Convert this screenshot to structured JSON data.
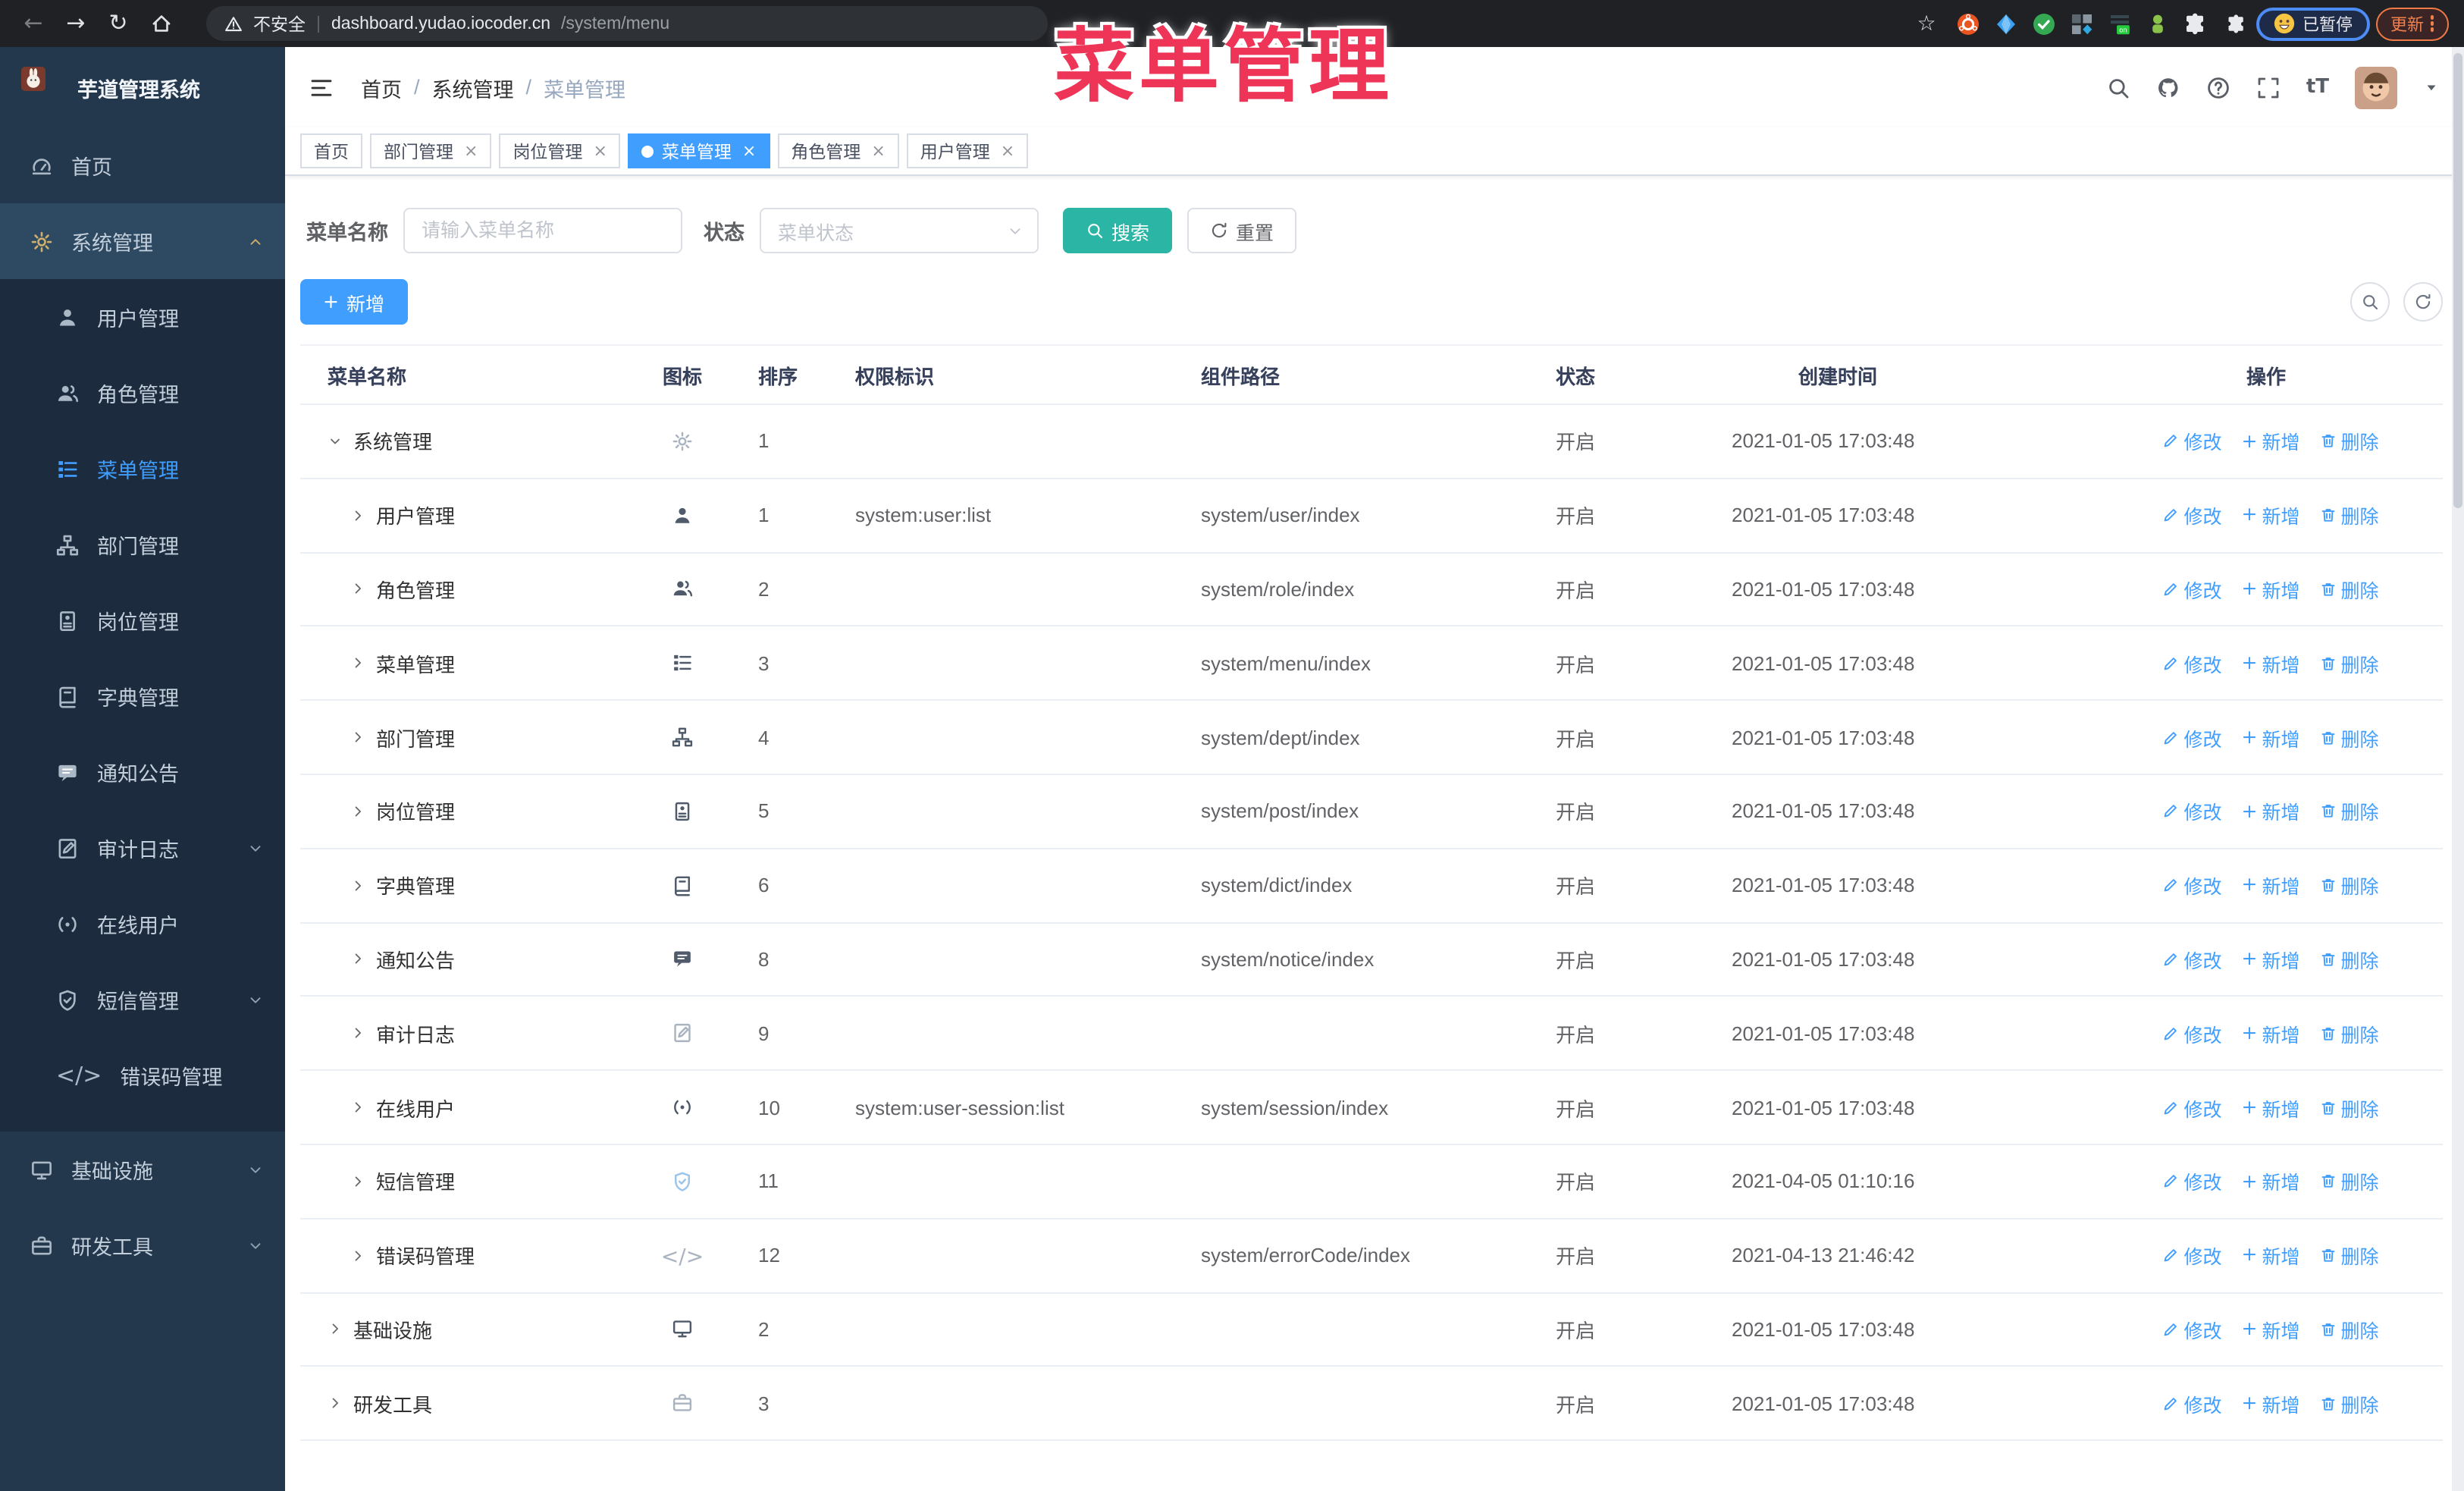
{
  "colors": {
    "accent": "#409eff",
    "teal": "#2bb5a5",
    "overlay": "#ee3558",
    "sidebar_bg": "#24384d"
  },
  "browser": {
    "insecure_label": "不安全",
    "url_host": "dashboard.yudao.iocoder.cn",
    "url_path": "/system/menu",
    "extension_icons": [
      "ubuntu",
      "gem",
      "verified",
      "grid",
      "onpage",
      "bot",
      "puzzle"
    ],
    "paused_badge": "已暂停",
    "update_button": "更新"
  },
  "overlay": {
    "title": "菜单管理"
  },
  "sidebar": {
    "logo_title": "芋道管理系统",
    "items": [
      {
        "label": "首页",
        "icon": "dashboard"
      },
      {
        "label": "系统管理",
        "icon": "gear",
        "highlight": true,
        "arrow": "chevron-up",
        "children": [
          {
            "label": "用户管理",
            "icon": "user"
          },
          {
            "label": "角色管理",
            "icon": "users"
          },
          {
            "label": "菜单管理",
            "icon": "menu",
            "active": true
          },
          {
            "label": "部门管理",
            "icon": "org"
          },
          {
            "label": "岗位管理",
            "icon": "post"
          },
          {
            "label": "字典管理",
            "icon": "dict"
          },
          {
            "label": "通知公告",
            "icon": "message"
          },
          {
            "label": "审计日志",
            "icon": "log",
            "arrow": "chevron-down"
          },
          {
            "label": "在线用户",
            "icon": "online"
          },
          {
            "label": "短信管理",
            "icon": "shield",
            "arrow": "chevron-down"
          },
          {
            "label": "错误码管理",
            "icon": "code"
          }
        ]
      },
      {
        "label": "基础设施",
        "icon": "monitor",
        "arrow": "chevron-down"
      },
      {
        "label": "研发工具",
        "icon": "toolbox",
        "arrow": "chevron-down"
      }
    ]
  },
  "header": {
    "breadcrumb": [
      "首页",
      "系统管理",
      "菜单管理"
    ]
  },
  "tabs": [
    {
      "label": "首页",
      "closable": false,
      "active": false
    },
    {
      "label": "部门管理",
      "closable": true,
      "active": false
    },
    {
      "label": "岗位管理",
      "closable": true,
      "active": false
    },
    {
      "label": "菜单管理",
      "closable": true,
      "active": true
    },
    {
      "label": "角色管理",
      "closable": true,
      "active": false
    },
    {
      "label": "用户管理",
      "closable": true,
      "active": false
    }
  ],
  "filters": {
    "name_label": "菜单名称",
    "name_placeholder": "请输入菜单名称",
    "name_value": "",
    "status_label": "状态",
    "status_placeholder": "菜单状态",
    "search_label": "搜索",
    "reset_label": "重置"
  },
  "toolbar": {
    "add_label": "新增"
  },
  "table": {
    "columns": [
      "菜单名称",
      "图标",
      "排序",
      "权限标识",
      "组件路径",
      "状态",
      "创建时间",
      "操作"
    ],
    "action_labels": {
      "edit": "修改",
      "add": "新增",
      "delete": "删除"
    },
    "rows": [
      {
        "name": "系统管理",
        "level": 0,
        "expanded": true,
        "icon": "gear",
        "icon_tone": "light",
        "sort": "1",
        "perm": "",
        "path": "",
        "status": "开启",
        "time": "2021-01-05 17:03:48"
      },
      {
        "name": "用户管理",
        "level": 1,
        "expanded": false,
        "icon": "user",
        "icon_tone": "dark",
        "sort": "1",
        "perm": "system:user:list",
        "path": "system/user/index",
        "status": "开启",
        "time": "2021-01-05 17:03:48"
      },
      {
        "name": "角色管理",
        "level": 1,
        "expanded": false,
        "icon": "users",
        "icon_tone": "dark",
        "sort": "2",
        "perm": "",
        "path": "system/role/index",
        "status": "开启",
        "time": "2021-01-05 17:03:48"
      },
      {
        "name": "菜单管理",
        "level": 1,
        "expanded": false,
        "icon": "menu",
        "icon_tone": "dark",
        "sort": "3",
        "perm": "",
        "path": "system/menu/index",
        "status": "开启",
        "time": "2021-01-05 17:03:48"
      },
      {
        "name": "部门管理",
        "level": 1,
        "expanded": false,
        "icon": "org",
        "icon_tone": "dark",
        "sort": "4",
        "perm": "",
        "path": "system/dept/index",
        "status": "开启",
        "time": "2021-01-05 17:03:48"
      },
      {
        "name": "岗位管理",
        "level": 1,
        "expanded": false,
        "icon": "post",
        "icon_tone": "dark",
        "sort": "5",
        "perm": "",
        "path": "system/post/index",
        "status": "开启",
        "time": "2021-01-05 17:03:48"
      },
      {
        "name": "字典管理",
        "level": 1,
        "expanded": false,
        "icon": "dict",
        "icon_tone": "dark",
        "sort": "6",
        "perm": "",
        "path": "system/dict/index",
        "status": "开启",
        "time": "2021-01-05 17:03:48"
      },
      {
        "name": "通知公告",
        "level": 1,
        "expanded": false,
        "icon": "message",
        "icon_tone": "dark",
        "sort": "8",
        "perm": "",
        "path": "system/notice/index",
        "status": "开启",
        "time": "2021-01-05 17:03:48"
      },
      {
        "name": "审计日志",
        "level": 1,
        "expanded": false,
        "icon": "log",
        "icon_tone": "light",
        "sort": "9",
        "perm": "",
        "path": "",
        "status": "开启",
        "time": "2021-01-05 17:03:48"
      },
      {
        "name": "在线用户",
        "level": 1,
        "expanded": false,
        "icon": "online",
        "icon_tone": "dark",
        "sort": "10",
        "perm": "system:user-session:list",
        "path": "system/session/index",
        "status": "开启",
        "time": "2021-01-05 17:03:48"
      },
      {
        "name": "短信管理",
        "level": 1,
        "expanded": false,
        "icon": "shield",
        "icon_tone": "blue",
        "sort": "11",
        "perm": "",
        "path": "",
        "status": "开启",
        "time": "2021-04-05 01:10:16"
      },
      {
        "name": "错误码管理",
        "level": 1,
        "expanded": false,
        "icon": "code",
        "icon_tone": "light",
        "sort": "12",
        "perm": "",
        "path": "system/errorCode/index",
        "status": "开启",
        "time": "2021-04-13 21:46:42"
      },
      {
        "name": "基础设施",
        "level": 0,
        "expanded": false,
        "icon": "monitor",
        "icon_tone": "dark",
        "sort": "2",
        "perm": "",
        "path": "",
        "status": "开启",
        "time": "2021-01-05 17:03:48"
      },
      {
        "name": "研发工具",
        "level": 0,
        "expanded": false,
        "icon": "toolbox",
        "icon_tone": "light",
        "sort": "3",
        "perm": "",
        "path": "",
        "status": "开启",
        "time": "2021-01-05 17:03:48"
      }
    ]
  }
}
